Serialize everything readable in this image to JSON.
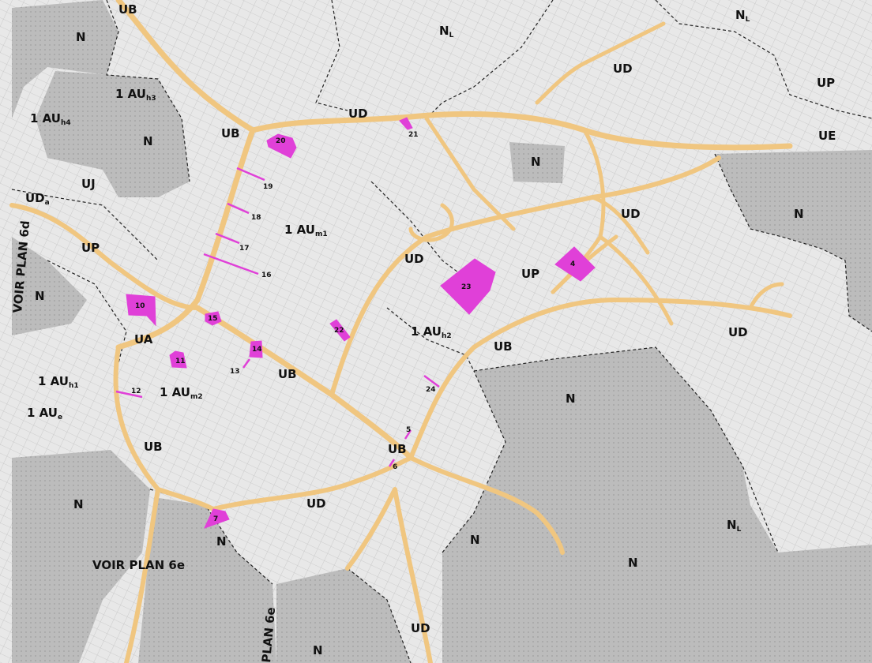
{
  "colors": {
    "road": "#f0c680",
    "site": "#e040d8",
    "zone_n": "#bdbdbd",
    "zone_urban": "#e6e6e6",
    "boundary": "#222222"
  },
  "labels": {
    "ub_top": "UB",
    "n_top": "N",
    "nl_top": "N",
    "nl_top_sub": "L",
    "nl_tr": "N",
    "nl_tr_sub": "L",
    "ud_ne": "UD",
    "up_ne": "UP",
    "ue": "UE",
    "au_h3": "1 AU",
    "au_h3_sub": "h3",
    "au_h4": "1 AU",
    "au_h4_sub": "h4",
    "n_left": "N",
    "ub_20": "UB",
    "ud_top": "UD",
    "n_center": "N",
    "uj": "UJ",
    "uda": "UD",
    "uda_sub": "a",
    "voir_6d": "VOIR PLAN 6d",
    "au_m1": "1 AU",
    "au_m1_sub": "m1",
    "ud_east": "UD",
    "n_east": "N",
    "up_west": "UP",
    "n_west": "N",
    "ud_mid": "UD",
    "up_mid": "UP",
    "ua": "UA",
    "au_h2": "1 AU",
    "au_h2_sub": "h2",
    "ub_mid": "UB",
    "ud_right": "UD",
    "ub_center": "UB",
    "au_h1": "1 AU",
    "au_h1_sub": "h1",
    "au_m2": "1 AU",
    "au_m2_sub": "m2",
    "au_e": "1 AU",
    "au_e_sub": "e",
    "n_se": "N",
    "ub_sw": "UB",
    "ub_bottom": "UB",
    "n_sw": "N",
    "ud_bottom": "UD",
    "n_bottom": "N",
    "n_s2": "N",
    "n_s3": "N",
    "nl_br": "N",
    "nl_br_sub": "L",
    "voir_6e": "VOIR PLAN 6e",
    "plan_6e": "PLAN 6e",
    "ud_south": "UD",
    "n_south": "N"
  },
  "sites": [
    {
      "id": "1",
      "label": "4"
    },
    {
      "id": "2",
      "label": "5"
    },
    {
      "id": "3",
      "label": "6"
    },
    {
      "id": "4",
      "label": "7"
    },
    {
      "id": "5",
      "label": "10"
    },
    {
      "id": "6",
      "label": "11"
    },
    {
      "id": "7",
      "label": "12"
    },
    {
      "id": "8",
      "label": "13"
    },
    {
      "id": "9",
      "label": "14"
    },
    {
      "id": "10",
      "label": "15"
    },
    {
      "id": "11",
      "label": "16"
    },
    {
      "id": "12",
      "label": "17"
    },
    {
      "id": "13",
      "label": "18"
    },
    {
      "id": "14",
      "label": "19"
    },
    {
      "id": "15",
      "label": "20"
    },
    {
      "id": "16",
      "label": "21"
    },
    {
      "id": "17",
      "label": "22"
    },
    {
      "id": "18",
      "label": "23"
    },
    {
      "id": "19",
      "label": "24"
    }
  ]
}
